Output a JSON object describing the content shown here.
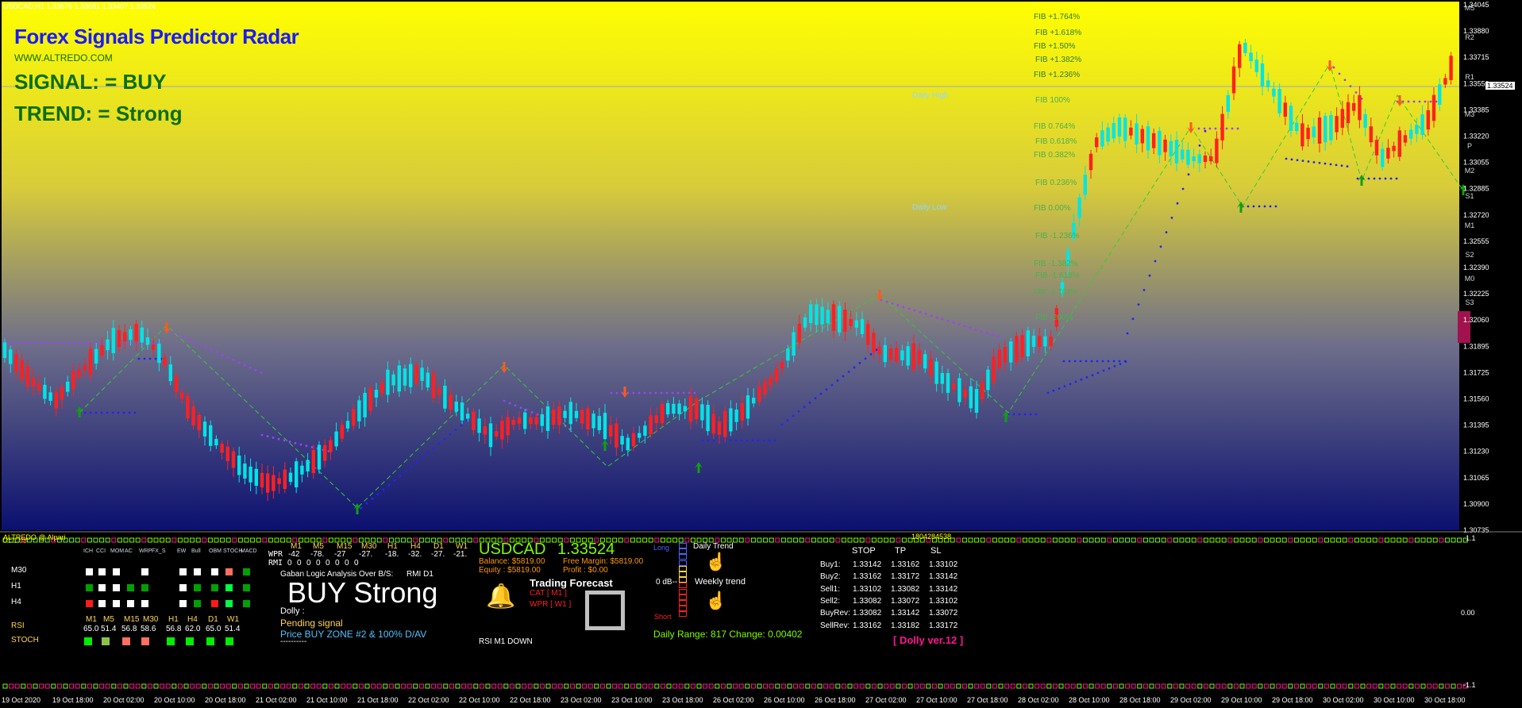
{
  "window": {
    "title": "USDCAD,H1  1.33676  1.33681  1.33407  1.33524",
    "logo_title": "Forex Signals Predictor Radar",
    "website": "WWW.ALTREDO.COM",
    "signal_line": "SIGNAL:  =  BUY",
    "trend_line": "TREND: =  Strong"
  },
  "colors": {
    "bull": "#00e5e5",
    "bear": "#ff2020",
    "title_blue": "#1a1aff",
    "signal_green": "#0b6e0b",
    "zigzag": "#32cd32",
    "dots_blue": "#2323ff",
    "dots_purple": "#a040ff",
    "panel_bg": "#000000",
    "bg_top": "#ffff00",
    "bg_bottom": "#0b1070"
  },
  "price_axis": {
    "labels": [
      "1.34045",
      "1.33880",
      "1.33715",
      "1.33550",
      "1.33385",
      "1.33220",
      "1.33055",
      "1.32885",
      "1.32720",
      "1.32555",
      "1.32390",
      "1.32225",
      "1.32060",
      "1.31895",
      "1.31725",
      "1.31560",
      "1.31395",
      "1.31230",
      "1.31065",
      "1.30900",
      "1.30735"
    ],
    "current": "1.33524",
    "pivot_labels": [
      "M5",
      "R2",
      "R1",
      "M3",
      "P",
      "M2",
      "S1",
      "M1",
      "S2",
      "M0",
      "S3"
    ],
    "indicator_top": "1.1",
    "indicator_zero": "0.00",
    "indicator_bottom": "-1.1"
  },
  "fib": {
    "levels": [
      "FIB +1.764%",
      "FIB +1.618%",
      "FIB +1.50%",
      "FIB +1.382%",
      "FIB +1.236%",
      "FIB 100%",
      "FIB 0.764%",
      "FIB 0.618%",
      "FIB 0.382%",
      "FIB 0.236%",
      "FIB 0.00%",
      "FIB -1.236%",
      "FIB -1.382%",
      "FIB -1.618%",
      "FIB -1.764%",
      "FIB -200%"
    ],
    "daily_high": "Daily High",
    "daily_low": "Daily Low"
  },
  "time_axis": [
    "19 Oct 2020",
    "19 Oct 18:00",
    "20 Oct 02:00",
    "20 Oct 10:00",
    "20 Oct 18:00",
    "21 Oct 02:00",
    "21 Oct 10:00",
    "21 Oct 18:00",
    "22 Oct 02:00",
    "22 Oct 10:00",
    "22 Oct 18:00",
    "23 Oct 02:00",
    "23 Oct 10:00",
    "23 Oct 18:00",
    "26 Oct 02:00",
    "26 Oct 10:00",
    "26 Oct 18:00",
    "27 Oct 02:00",
    "27 Oct 10:00",
    "27 Oct 18:00",
    "28 Oct 02:00",
    "28 Oct 10:00",
    "28 Oct 18:00",
    "29 Oct 02:00",
    "29 Oct 10:00",
    "29 Oct 18:00",
    "30 Oct 02:00",
    "30 Oct 10:00",
    "30 Oct 18:00"
  ],
  "panel": {
    "label_left": "ALTREDO @ Alpari",
    "label_left2": "01.1.08",
    "label_mid": "1804284538",
    "grid_headers": [
      "ICH",
      "CCI",
      "MOM",
      "AC",
      "WRP",
      "FX_S",
      "EW",
      "Bull",
      "OBM",
      "STOCH",
      "MACD"
    ],
    "grid_rows": [
      {
        "label": "M30",
        "cells": [
          "w",
          "w",
          "w",
          "",
          "w",
          "",
          "w",
          "w",
          "w",
          "o",
          "g"
        ]
      },
      {
        "label": "H1",
        "cells": [
          "g",
          "w",
          "w",
          "g",
          "g",
          "",
          "w",
          "g",
          "g",
          "B",
          "g"
        ]
      },
      {
        "label": "H4",
        "cells": [
          "r",
          "w",
          "w",
          "w",
          "w",
          "",
          "w",
          "g",
          "r",
          "B",
          "g"
        ]
      }
    ],
    "tf_headers": [
      "M1",
      "M5",
      "M15",
      "M30",
      "H1",
      "H4",
      "D1",
      "W1"
    ],
    "rsi_label": "RSI",
    "rsi_values": [
      "65.0",
      "51.4",
      "56.8",
      "58.6",
      "56.8",
      "62.0",
      "65.0",
      "51.4"
    ],
    "stoch_label": "STOCH",
    "stoch_colors": [
      "#00ee00",
      "#8bc34a",
      "#ff7060",
      "#ff7060",
      "#00ee00",
      "#00ee00",
      "#00ee00",
      "#00ee00"
    ],
    "wpr_label": "WPR",
    "wpr_values": [
      "-42",
      "-78.",
      "-27",
      "-27.",
      "-18.",
      "-32.",
      "-27.",
      "-21."
    ],
    "rmi_label": "RMI",
    "rmi_values": [
      "0",
      "0",
      "0",
      "0",
      "0",
      "0",
      "0",
      "0"
    ],
    "gaban_title": "Gaban Logic Analysis Over B/S:",
    "gaban_tf": "RMI D1",
    "big_signal": "BUY  Strong",
    "dolly_label": "Dolly :",
    "pending": "Pending signal",
    "price_zone": "Price BUY ZONE #2 & 100% D/AV",
    "dashes": "----------",
    "symbol": "USDCAD",
    "price": "1.33524",
    "balance": "Balance:  $5819.00",
    "free_margin": "Free Margin: $5819.00",
    "equity": "Equity   :  $5819.00",
    "profit": "Profit :  $0.00",
    "forecast_title": "Trading Forecast",
    "cat": "CAT  [ M1 ]",
    "wpr_fc": "WPR  [ W1 ]",
    "rsi_down": "RSI M1 DOWN",
    "long": "Long",
    "short": "Short",
    "db": "0 dB--",
    "daily_trend": "Daily Trend",
    "weekly_trend": "Weekly trend",
    "daily_range": "Daily Range: 817  Change: 0.00402",
    "stop_table": {
      "headers": [
        "STOP",
        "TP",
        "SL"
      ],
      "rows": [
        {
          "label": "Buy1:",
          "v": [
            "1.33142",
            "1.33162",
            "1.33102"
          ]
        },
        {
          "label": "Buy2:",
          "v": [
            "1.33162",
            "1.33172",
            "1.33142"
          ]
        },
        {
          "label": "Sell1:",
          "v": [
            "1.33102",
            "1.33082",
            "1.33142"
          ]
        },
        {
          "label": "Sell2:",
          "v": [
            "1.33082",
            "1.33072",
            "1.33102"
          ]
        },
        {
          "label": "BuyRev:",
          "v": [
            "1.33082",
            "1.33142",
            "1.33072"
          ]
        },
        {
          "label": "SellRev:",
          "v": [
            "1.33162",
            "1.33182",
            "1.33172"
          ]
        }
      ]
    },
    "version": "[ Dolly ver.12 ]"
  }
}
